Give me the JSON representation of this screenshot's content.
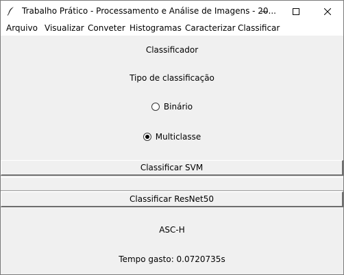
{
  "window": {
    "title": "Trabalho Prático - Processamento e Análise de Imagens - 20...",
    "controls": [
      "minimize",
      "maximize",
      "close"
    ]
  },
  "menu": {
    "items": [
      "Arquivo",
      "Visualizar",
      "Conveter",
      "Histogramas",
      "Caracterizar",
      "Classificar"
    ]
  },
  "classifier": {
    "header": "Classificador",
    "type_label": "Tipo de classificação",
    "options": [
      {
        "label": "Binário",
        "selected": false
      },
      {
        "label": "Multiclasse",
        "selected": true
      }
    ],
    "svm_button": "Classificar SVM",
    "resnet_button": "Classificar ResNet50",
    "result": "ASC-H",
    "time_label": "Tempo gasto: 0.0720735s"
  },
  "icons": {
    "app": "feather-icon",
    "minimize": "minimize-icon",
    "maximize": "maximize-icon",
    "close": "close-icon"
  }
}
